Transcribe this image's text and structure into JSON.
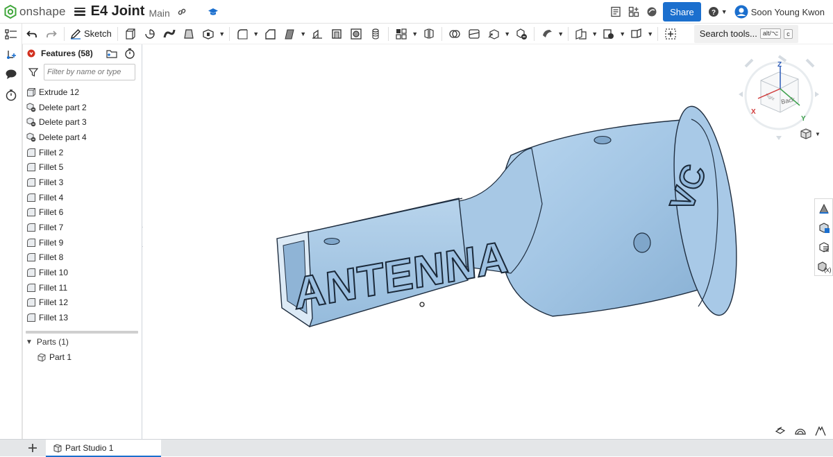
{
  "app": {
    "brand": "onshape",
    "document_title": "E4 Joint",
    "workspace": "Main",
    "share_label": "Share",
    "user_name": "Soon Young Kwon",
    "brand_color": "#3fa63a",
    "accent_color": "#1b6fce"
  },
  "toolbar": {
    "sketch_label": "Sketch",
    "search_label": "Search tools...",
    "search_shortcut_mod": "alt/⌥",
    "search_shortcut_key": "c"
  },
  "feature_panel": {
    "title": "Features (58)",
    "filter_placeholder": "Filter by name or type",
    "features": [
      {
        "label": "Extrude 12",
        "icon": "extrude-icon"
      },
      {
        "label": "Delete part 2",
        "icon": "delete-part-icon"
      },
      {
        "label": "Delete part 3",
        "icon": "delete-part-icon"
      },
      {
        "label": "Delete part 4",
        "icon": "delete-part-icon"
      },
      {
        "label": "Fillet 2",
        "icon": "fillet-icon"
      },
      {
        "label": "Fillet 5",
        "icon": "fillet-icon"
      },
      {
        "label": "Fillet 3",
        "icon": "fillet-icon"
      },
      {
        "label": "Fillet 4",
        "icon": "fillet-icon"
      },
      {
        "label": "Fillet 6",
        "icon": "fillet-icon"
      },
      {
        "label": "Fillet 7",
        "icon": "fillet-icon"
      },
      {
        "label": "Fillet 9",
        "icon": "fillet-icon"
      },
      {
        "label": "Fillet 8",
        "icon": "fillet-icon"
      },
      {
        "label": "Fillet 10",
        "icon": "fillet-icon"
      },
      {
        "label": "Fillet 11",
        "icon": "fillet-icon"
      },
      {
        "label": "Fillet 12",
        "icon": "fillet-icon"
      },
      {
        "label": "Fillet 13",
        "icon": "fillet-icon"
      }
    ],
    "parts_label": "Parts (1)",
    "parts": [
      {
        "label": "Part 1"
      }
    ]
  },
  "viewport": {
    "model_color": "#a9cbe8",
    "engraved_text": "ANTENNA",
    "engraved_text_2": "VC",
    "view_cube": {
      "face_label": "Back",
      "face_label_2": "Right",
      "axis_x": "X",
      "axis_y": "Y",
      "axis_z": "Z"
    }
  },
  "tabs": [
    {
      "label": "Part Studio 1",
      "active": true
    }
  ]
}
